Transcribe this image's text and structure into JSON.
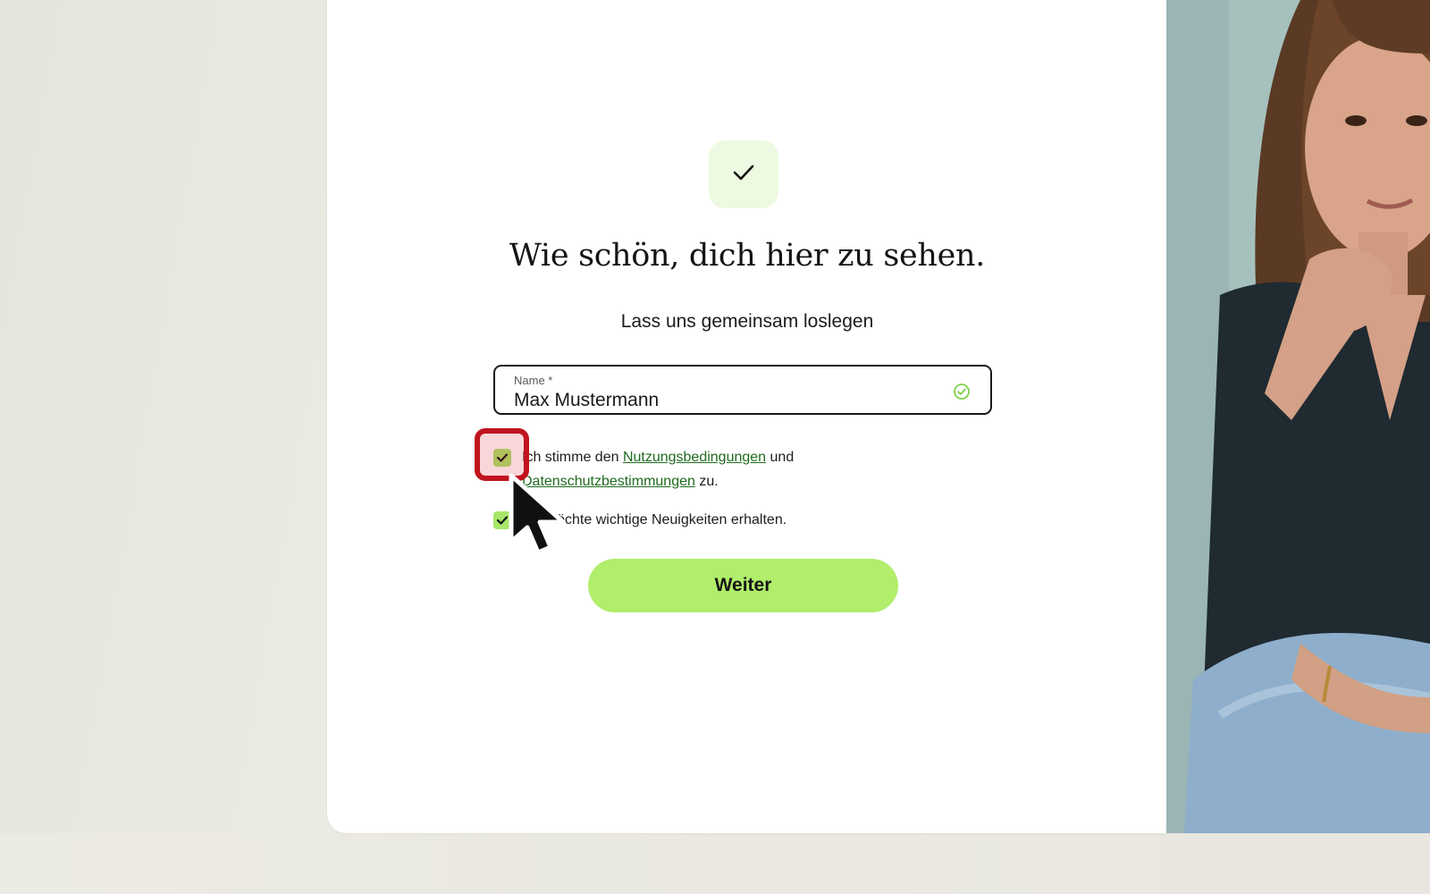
{
  "form": {
    "title": "Wie schön, dich hier zu sehen.",
    "subtitle": "Lass uns gemeinsam loslegen",
    "name_field": {
      "label": "Name *",
      "value": "Max Mustermann",
      "valid": true
    },
    "consent_terms": {
      "checked": true,
      "text_before": "Ich stimme den ",
      "terms_link": "Nutzungsbedingungen",
      "text_middle": " und",
      "privacy_link": "Datenschutzbestimmungen",
      "text_after": " zu."
    },
    "consent_news": {
      "checked": true,
      "text": "Ich möchte wichtige Neuigkeiten erhalten."
    },
    "submit_label": "Weiter"
  },
  "icons": {
    "badge": "checkmark-icon",
    "field_status": "check-circle-icon",
    "checkbox": "checkmark-icon",
    "pointer": "mouse-cursor-icon"
  },
  "colors": {
    "accent": "#b0ee6b",
    "checkbox": "#a6e66a",
    "badge_bg": "#eef9e1",
    "link": "#1f6a1f",
    "highlight": "#c0141f",
    "valid": "#7fd14a"
  }
}
